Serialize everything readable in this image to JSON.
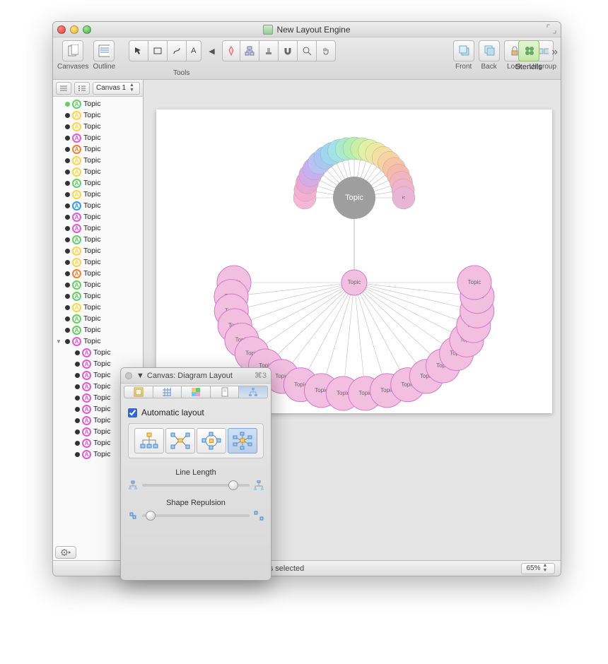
{
  "window": {
    "title": "New Layout Engine"
  },
  "toolbar": {
    "canvases": "Canvases",
    "outline": "Outline",
    "tools": "Tools",
    "front": "Front",
    "back": "Back",
    "lock": "Lock",
    "ungroup": "Ungroup",
    "stencils": "Stencils"
  },
  "sidebar": {
    "canvas_selector": "Canvas 1",
    "items": [
      {
        "dot": "#66cc66",
        "a": "#66cc66",
        "label": "Topic",
        "disc": ""
      },
      {
        "dot": "#333333",
        "a": "#f5d84a",
        "label": "Topic",
        "disc": ""
      },
      {
        "dot": "#333333",
        "a": "#f5d84a",
        "label": "Topic",
        "disc": ""
      },
      {
        "dot": "#333333",
        "a": "#e05ad0",
        "label": "Topic",
        "disc": ""
      },
      {
        "dot": "#333333",
        "a": "#f08030",
        "label": "Topic",
        "disc": ""
      },
      {
        "dot": "#333333",
        "a": "#f5d84a",
        "label": "Topic",
        "disc": ""
      },
      {
        "dot": "#333333",
        "a": "#f5d84a",
        "label": "Topic",
        "disc": ""
      },
      {
        "dot": "#333333",
        "a": "#66cc66",
        "label": "Topic",
        "disc": ""
      },
      {
        "dot": "#333333",
        "a": "#f5d84a",
        "label": "Topic",
        "disc": ""
      },
      {
        "dot": "#333333",
        "a": "#3399ee",
        "label": "Topic",
        "disc": ""
      },
      {
        "dot": "#333333",
        "a": "#e05ad0",
        "label": "Topic",
        "disc": ""
      },
      {
        "dot": "#333333",
        "a": "#e05ad0",
        "label": "Topic",
        "disc": ""
      },
      {
        "dot": "#333333",
        "a": "#66cc66",
        "label": "Topic",
        "disc": ""
      },
      {
        "dot": "#333333",
        "a": "#f5d84a",
        "label": "Topic",
        "disc": ""
      },
      {
        "dot": "#333333",
        "a": "#f5d84a",
        "label": "Topic",
        "disc": ""
      },
      {
        "dot": "#333333",
        "a": "#f08030",
        "label": "Topic",
        "disc": ""
      },
      {
        "dot": "#333333",
        "a": "#66cc66",
        "label": "Topic",
        "disc": ""
      },
      {
        "dot": "#333333",
        "a": "#66cc66",
        "label": "Topic",
        "disc": ""
      },
      {
        "dot": "#333333",
        "a": "#f5d84a",
        "label": "Topic",
        "disc": ""
      },
      {
        "dot": "#333333",
        "a": "#66cc66",
        "label": "Topic",
        "disc": ""
      },
      {
        "dot": "#333333",
        "a": "#66cc66",
        "label": "Topic",
        "disc": ""
      },
      {
        "dot": "#333333",
        "a": "#e05ad0",
        "label": "Topic",
        "disc": "▼"
      },
      {
        "dot": "#333333",
        "a": "#e05ad0",
        "label": "Topic",
        "indent": true
      },
      {
        "dot": "#333333",
        "a": "#e05ad0",
        "label": "Topic",
        "indent": true
      },
      {
        "dot": "#333333",
        "a": "#e05ad0",
        "label": "Topic",
        "indent": true
      },
      {
        "dot": "#333333",
        "a": "#e05ad0",
        "label": "Topic",
        "indent": true
      },
      {
        "dot": "#333333",
        "a": "#e05ad0",
        "label": "Topic",
        "indent": true
      },
      {
        "dot": "#333333",
        "a": "#e05ad0",
        "label": "Topic",
        "indent": true
      },
      {
        "dot": "#333333",
        "a": "#e05ad0",
        "label": "Topic",
        "indent": true
      },
      {
        "dot": "#333333",
        "a": "#e05ad0",
        "label": "Topic",
        "indent": true
      },
      {
        "dot": "#333333",
        "a": "#e05ad0",
        "label": "Topic",
        "indent": true
      },
      {
        "dot": "#333333",
        "a": "#e05ad0",
        "label": "Topic",
        "indent": true
      }
    ]
  },
  "canvas_diagram": {
    "center_top": {
      "label": "Topic",
      "color": "#9e9e9e"
    },
    "center_bottom": {
      "label": "Topic",
      "color": "#f3bfe1"
    },
    "arc_top": {
      "count": 21,
      "radius": 70,
      "size": 16,
      "label": "Topic",
      "colors": [
        "#f7b6d6",
        "#f5b0cf",
        "#e8a8d6",
        "#d7abe6",
        "#c7b0f0",
        "#bac2f3",
        "#a7c8f2",
        "#9fd6f0",
        "#a3e3e7",
        "#a8eccd",
        "#b3efb3",
        "#c9efa6",
        "#dff1a3",
        "#eceaa2",
        "#f4dfa3",
        "#f7d3a3",
        "#f8c4a6",
        "#f6baad",
        "#f3b5bd",
        "#efb3cc",
        "#eab4d7"
      ]
    },
    "arc_bottom": {
      "count": 22,
      "radius": 170,
      "size": 24,
      "label": "Topic",
      "color": "#f3bfe1"
    }
  },
  "statusbar": {
    "selected": "nvas selected",
    "zoom": "65%"
  },
  "inspector": {
    "title": "Canvas: Diagram Layout",
    "shortcut": "⌘3",
    "auto_label": "Automatic layout",
    "auto_checked": true,
    "style_selected": 3,
    "line_length_label": "Line Length",
    "shape_repulsion_label": "Shape Repulsion"
  }
}
